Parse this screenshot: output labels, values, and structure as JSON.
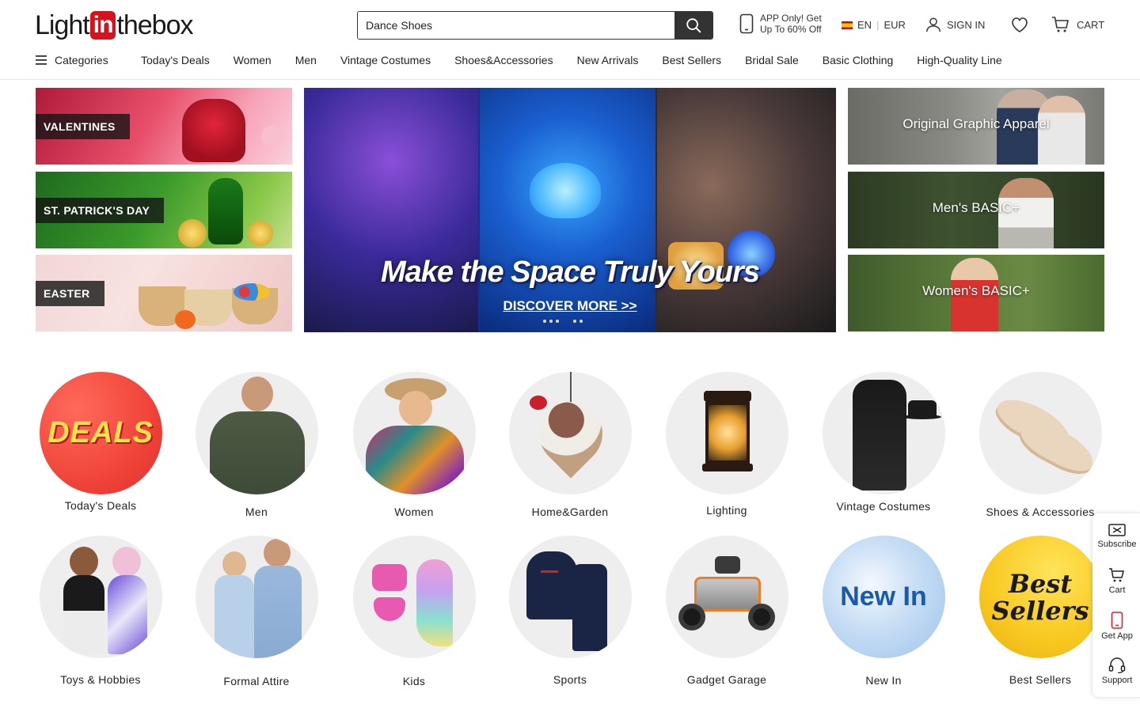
{
  "header": {
    "logo": {
      "part1": "Light",
      "part2": "in",
      "part3": "thebox"
    },
    "search": {
      "value": "Dance Shoes",
      "placeholder": "Dance Shoes"
    },
    "app_promo": {
      "line1": "APP Only! Get",
      "line2": "Up To 60% Off"
    },
    "language": "EN",
    "currency": "EUR",
    "signin_label": "SIGN IN",
    "cart_label": "CART"
  },
  "nav": {
    "categories_label": "Categories",
    "items": [
      "Today's Deals",
      "Women",
      "Men",
      "Vintage Costumes",
      "Shoes&Accessories",
      "New Arrivals",
      "Best Sellers",
      "Bridal Sale",
      "Basic Clothing",
      "High-Quality Line"
    ]
  },
  "left_banners": [
    "VALENTINES",
    "ST. PATRICK'S DAY",
    "EASTER"
  ],
  "hero": {
    "headline": "Make the Space Truly Yours",
    "cta": "DISCOVER MORE >>"
  },
  "right_banners": [
    "Original Graphic Apparel",
    "Men's BASIC+",
    "Women's BASIC+"
  ],
  "categories": [
    {
      "label": "Today's Deals",
      "art": "DEALS"
    },
    {
      "label": "Men"
    },
    {
      "label": "Women"
    },
    {
      "label": "Home&Garden"
    },
    {
      "label": "Lighting"
    },
    {
      "label": "Vintage Costumes"
    },
    {
      "label": "Shoes & Accessories"
    },
    {
      "label": "Toys & Hobbies"
    },
    {
      "label": "Formal Attire"
    },
    {
      "label": "Kids"
    },
    {
      "label": "Sports"
    },
    {
      "label": "Gadget Garage"
    },
    {
      "label": "New In",
      "art": "New In"
    },
    {
      "label": "Best Sellers",
      "art_line1": "Best",
      "art_line2": "Sellers"
    }
  ],
  "side_rail": {
    "subscribe": "Subscribe",
    "cart": "Cart",
    "get_app": "Get App",
    "support": "Support"
  },
  "colors": {
    "brand_red": "#d6121f",
    "dark": "#333333"
  }
}
